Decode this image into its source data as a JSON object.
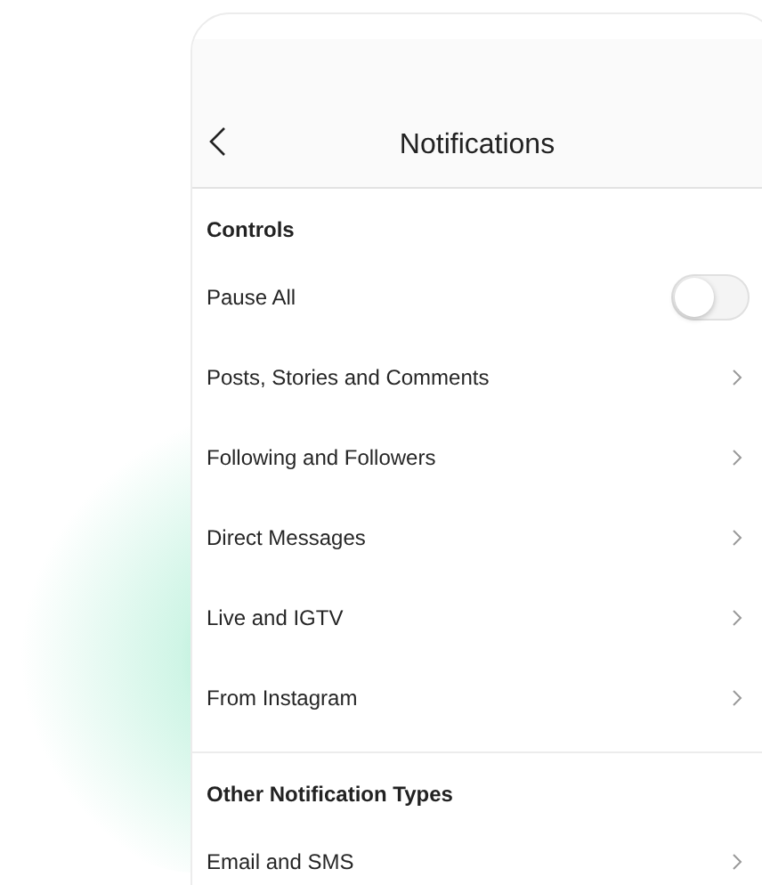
{
  "header": {
    "title": "Notifications"
  },
  "sections": [
    {
      "title": "Controls",
      "rows": [
        {
          "label": "Pause All",
          "kind": "toggle",
          "on": false
        },
        {
          "label": "Posts, Stories and Comments",
          "kind": "link"
        },
        {
          "label": "Following and Followers",
          "kind": "link"
        },
        {
          "label": "Direct Messages",
          "kind": "link"
        },
        {
          "label": "Live and IGTV",
          "kind": "link"
        },
        {
          "label": "From Instagram",
          "kind": "link"
        }
      ]
    },
    {
      "title": "Other Notification Types",
      "rows": [
        {
          "label": "Email and SMS",
          "kind": "link"
        }
      ]
    }
  ]
}
